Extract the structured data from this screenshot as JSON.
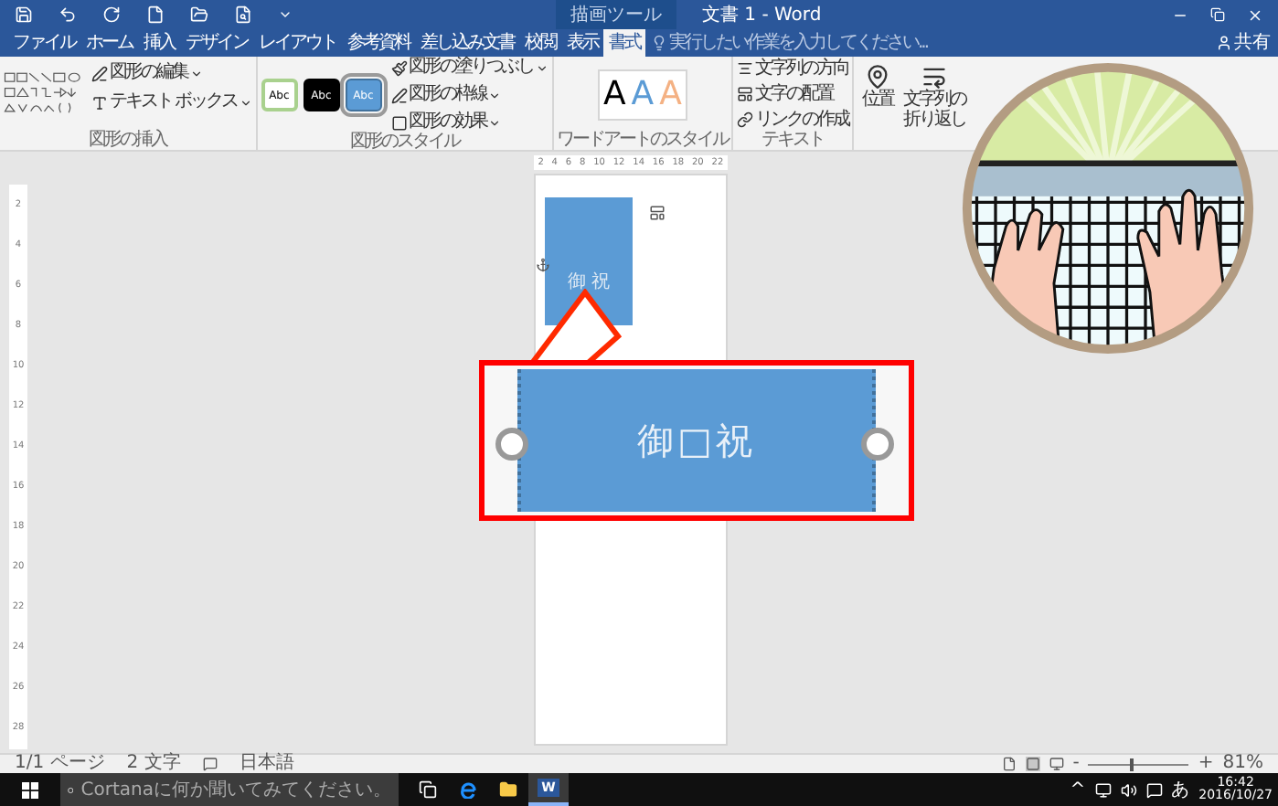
{
  "title_bar": {
    "context_group": "描画ツール",
    "title": "文書 1 - Word"
  },
  "tabs": [
    {
      "label": "ファイル",
      "selected": false
    },
    {
      "label": "ホーム",
      "selected": false
    },
    {
      "label": "挿入",
      "selected": false
    },
    {
      "label": "デザイン",
      "selected": false
    },
    {
      "label": "レイアウト",
      "selected": false
    },
    {
      "label": "参考資料",
      "selected": false
    },
    {
      "label": "差し込み文書",
      "selected": false
    },
    {
      "label": "校閲",
      "selected": false
    },
    {
      "label": "表示",
      "selected": false
    },
    {
      "label": "書式",
      "selected": true
    }
  ],
  "tell_me": {
    "placeholder": "実行したい作業を入力してください..."
  },
  "share": "共有",
  "ribbon": {
    "insert_shapes": {
      "commands": [
        "図形の編集",
        "テキスト ボックス"
      ],
      "group_label": "図形の挿入"
    },
    "shape_styles": {
      "swatches": [
        {
          "label": "Abc",
          "kind": "outline",
          "selected": false
        },
        {
          "label": "Abc",
          "kind": "dark",
          "selected": false
        },
        {
          "label": "Abc",
          "kind": "accent",
          "selected": true
        }
      ],
      "commands": [
        "図形の塗りつぶし",
        "図形の枠線",
        "図形の効果"
      ],
      "group_label": "図形のスタイル"
    },
    "wordart": {
      "styles": [
        {
          "label": "A",
          "color": "#000000"
        },
        {
          "label": "A",
          "color": "#5b9bd5"
        },
        {
          "label": "A",
          "color": "#f4b183"
        }
      ],
      "group_label": "ワードアートのスタイル"
    },
    "text": {
      "commands": [
        "文字列の方向",
        "文字の配置",
        "リンクの作成"
      ],
      "group_label": "テキスト"
    },
    "arrange": {
      "commands": [
        "位置",
        "文字列の折り返し"
      ]
    }
  },
  "ruler": {
    "horizontal": [
      "2",
      "4",
      "6",
      "8",
      "10",
      "12",
      "14",
      "16",
      "18",
      "20",
      "22"
    ],
    "vertical": [
      "2",
      "4",
      "6",
      "8",
      "10",
      "12",
      "14",
      "16",
      "18",
      "20",
      "22",
      "24",
      "26",
      "28"
    ]
  },
  "document": {
    "shape_text": "御 祝"
  },
  "callout": {
    "text": "御□祝"
  },
  "status_bar": {
    "page": "1/1 ページ",
    "words": "2 文字",
    "language": "日本語",
    "zoom_out": "-",
    "zoom": {
      "level": 0.42
    },
    "zoom_in": "+",
    "zoom_percent": "81%"
  },
  "taskbar": {
    "search": {
      "placeholder": "Cortanaに何か聞いてみてください。"
    },
    "apps": [
      {
        "kind": "task_view",
        "selected": false
      },
      {
        "kind": "edge",
        "selected": false
      },
      {
        "kind": "explorer",
        "selected": false
      },
      {
        "kind": "word",
        "label": "W",
        "selected": true
      }
    ],
    "tray": {
      "chevron": "^",
      "ime": "あ",
      "time": "16:42",
      "date": "2016/10/27"
    }
  }
}
